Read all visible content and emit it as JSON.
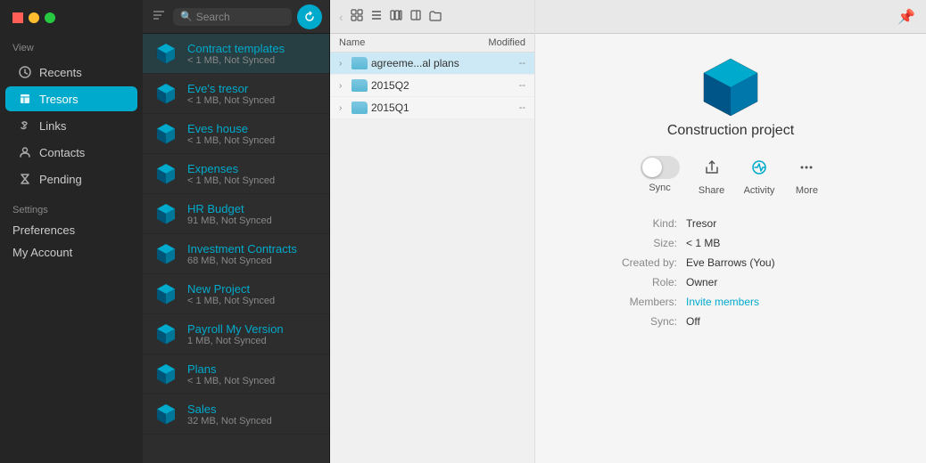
{
  "sidebar": {
    "view_label": "View",
    "items": [
      {
        "id": "recents",
        "label": "Recents",
        "icon": "clock"
      },
      {
        "id": "tresors",
        "label": "Tresors",
        "icon": "box",
        "active": true
      },
      {
        "id": "links",
        "label": "Links",
        "icon": "link"
      },
      {
        "id": "contacts",
        "label": "Contacts",
        "icon": "person"
      },
      {
        "id": "pending",
        "label": "Pending",
        "icon": "hourglass"
      }
    ],
    "settings_label": "Settings",
    "settings_items": [
      {
        "id": "preferences",
        "label": "Preferences"
      },
      {
        "id": "my-account",
        "label": "My Account"
      }
    ]
  },
  "search": {
    "placeholder": "Search"
  },
  "tresor_list": {
    "items": [
      {
        "id": "contract-templates",
        "name": "Contract templates",
        "meta": "< 1 MB, Not Synced"
      },
      {
        "id": "eves-tresor",
        "name": "Eve's tresor",
        "meta": "< 1 MB, Not Synced"
      },
      {
        "id": "eves-house",
        "name": "Eves house",
        "meta": "< 1 MB, Not Synced"
      },
      {
        "id": "expenses",
        "name": "Expenses",
        "meta": "< 1 MB, Not Synced"
      },
      {
        "id": "hr-budget",
        "name": "HR Budget",
        "meta": "91 MB, Not Synced"
      },
      {
        "id": "investment-contracts",
        "name": "Investment Contracts",
        "meta": "68 MB, Not Synced"
      },
      {
        "id": "new-project",
        "name": "New Project",
        "meta": "< 1 MB, Not Synced"
      },
      {
        "id": "payroll-my-version",
        "name": "Payroll My Version",
        "meta": "1 MB, Not Synced"
      },
      {
        "id": "plans",
        "name": "Plans",
        "meta": "< 1 MB, Not Synced"
      },
      {
        "id": "sales",
        "name": "Sales",
        "meta": "32 MB, Not Synced"
      }
    ]
  },
  "file_browser": {
    "columns": {
      "name": "Name",
      "modified": "Modified"
    },
    "files": [
      {
        "id": "agreement-plans",
        "name": "agreeme...al plans",
        "modified": "--"
      },
      {
        "id": "2015q2",
        "name": "2015Q2",
        "modified": "--"
      },
      {
        "id": "2015q1",
        "name": "2015Q1",
        "modified": "--"
      }
    ]
  },
  "detail": {
    "project_title": "Construction project",
    "actions": {
      "sync_label": "Sync",
      "share_label": "Share",
      "activity_label": "Activity",
      "more_label": "More"
    },
    "info": {
      "kind_label": "Kind:",
      "kind_value": "Tresor",
      "size_label": "Size:",
      "size_value": "< 1 MB",
      "created_by_label": "Created by:",
      "created_by_value": "Eve Barrows (You)",
      "role_label": "Role:",
      "role_value": "Owner",
      "members_label": "Members:",
      "members_value": "Invite members",
      "sync_label": "Sync:",
      "sync_value": "Off"
    }
  }
}
